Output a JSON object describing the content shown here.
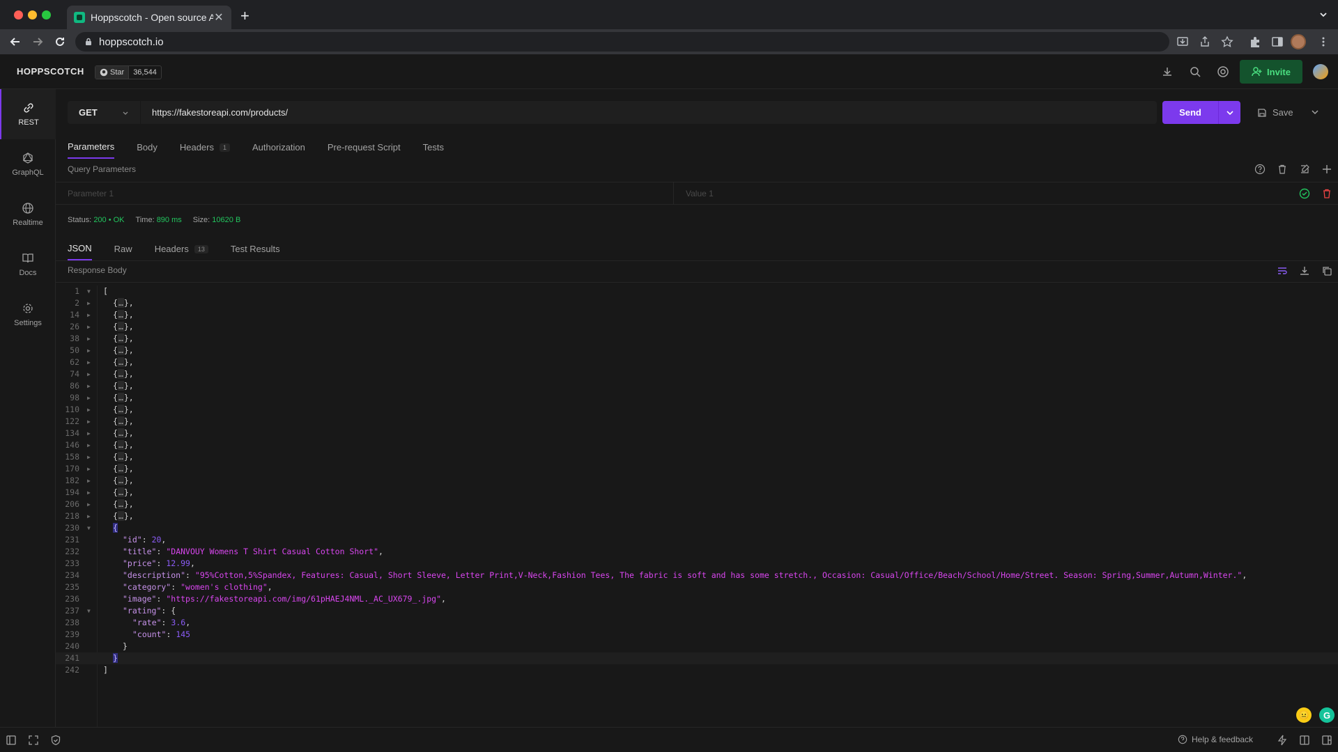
{
  "browser": {
    "tab_title": "Hoppscotch - Open source API",
    "url": "hoppscotch.io"
  },
  "app": {
    "brand": "HOPPSCOTCH",
    "github_star_label": "Star",
    "github_star_count": "36,544",
    "invite_label": "Invite"
  },
  "sidebar": {
    "items": [
      {
        "label": "REST",
        "icon": "link-icon"
      },
      {
        "label": "GraphQL",
        "icon": "graphql-icon"
      },
      {
        "label": "Realtime",
        "icon": "globe-icon"
      },
      {
        "label": "Docs",
        "icon": "book-icon"
      },
      {
        "label": "Settings",
        "icon": "gear-icon"
      }
    ]
  },
  "request": {
    "method": "GET",
    "url": "https://fakestoreapi.com/products/",
    "send_label": "Send",
    "save_label": "Save"
  },
  "request_tabs": [
    {
      "label": "Parameters",
      "badge": ""
    },
    {
      "label": "Body",
      "badge": ""
    },
    {
      "label": "Headers",
      "badge": "1"
    },
    {
      "label": "Authorization",
      "badge": ""
    },
    {
      "label": "Pre-request Script",
      "badge": ""
    },
    {
      "label": "Tests",
      "badge": ""
    }
  ],
  "query_params": {
    "title": "Query Parameters",
    "key_placeholder": "Parameter 1",
    "value_placeholder": "Value 1"
  },
  "status": {
    "status_label": "Status:",
    "status_value": "200 • OK",
    "time_label": "Time:",
    "time_value": "890 ms",
    "size_label": "Size:",
    "size_value": "10620 B"
  },
  "response_tabs": [
    {
      "label": "JSON",
      "badge": ""
    },
    {
      "label": "Raw",
      "badge": ""
    },
    {
      "label": "Headers",
      "badge": "13"
    },
    {
      "label": "Test Results",
      "badge": ""
    }
  ],
  "response_body_title": "Response Body",
  "collapsed_lines": [
    "2",
    "14",
    "26",
    "38",
    "50",
    "62",
    "74",
    "86",
    "98",
    "110",
    "122",
    "134",
    "146",
    "158",
    "170",
    "182",
    "194",
    "206",
    "218"
  ],
  "product": {
    "id": "20",
    "title": "DANVOUY Womens T Shirt Casual Cotton Short",
    "price": "12.99",
    "description": "95%Cotton,5%Spandex, Features: Casual, Short Sleeve, Letter Print,V-Neck,Fashion Tees, The fabric is soft and has some stretch., Occasion: Casual/Office/Beach/School/Home/Street. Season: Spring,Summer,Autumn,Winter.",
    "category": "women's clothing",
    "image": "https://fakestoreapi.com/img/61pHAEJ4NML._AC_UX679_.jpg",
    "rate": "3.6",
    "count": "145"
  },
  "footer": {
    "help_label": "Help & feedback"
  },
  "colors": {
    "accent": "#7c3aed",
    "success": "#22c55e",
    "json_string": "#d946ef",
    "json_number": "#8b5cf6"
  }
}
